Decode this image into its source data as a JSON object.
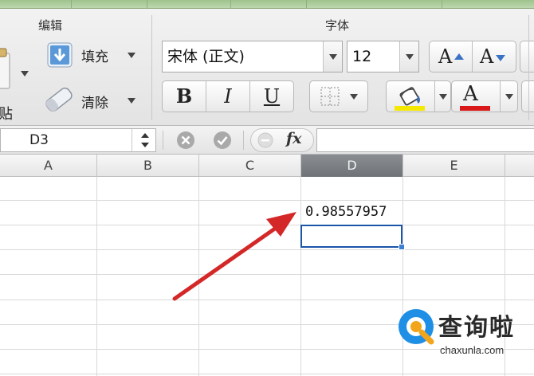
{
  "ribbon": {
    "edit_group_title": "编辑",
    "font_group_title": "字体",
    "paste_label": "贴",
    "fill_label": "填充",
    "clear_label": "清除",
    "font_name": "宋体 (正文)",
    "font_size": "12",
    "bold_label": "B",
    "italic_label": "I",
    "underline_label": "U",
    "grow_font_label": "A",
    "shrink_font_label": "A",
    "font_color_label": "A",
    "fill_color_hex": "#f5e800",
    "font_color_hex": "#d81818"
  },
  "formula_bar": {
    "cell_reference": "D3",
    "fx_label": "fx",
    "formula_value": ""
  },
  "grid": {
    "columns": [
      "A",
      "B",
      "C",
      "D",
      "E"
    ],
    "active_column": "D",
    "cells": [
      {
        "ref": "D2",
        "value": "0.98557957"
      }
    ],
    "selected_cell": "D3",
    "selection_color": "#1a55a8"
  },
  "annotation": {
    "arrow_color": "#d42828"
  },
  "watermark": {
    "brand": "查询啦",
    "url": "chaxunla.com"
  }
}
